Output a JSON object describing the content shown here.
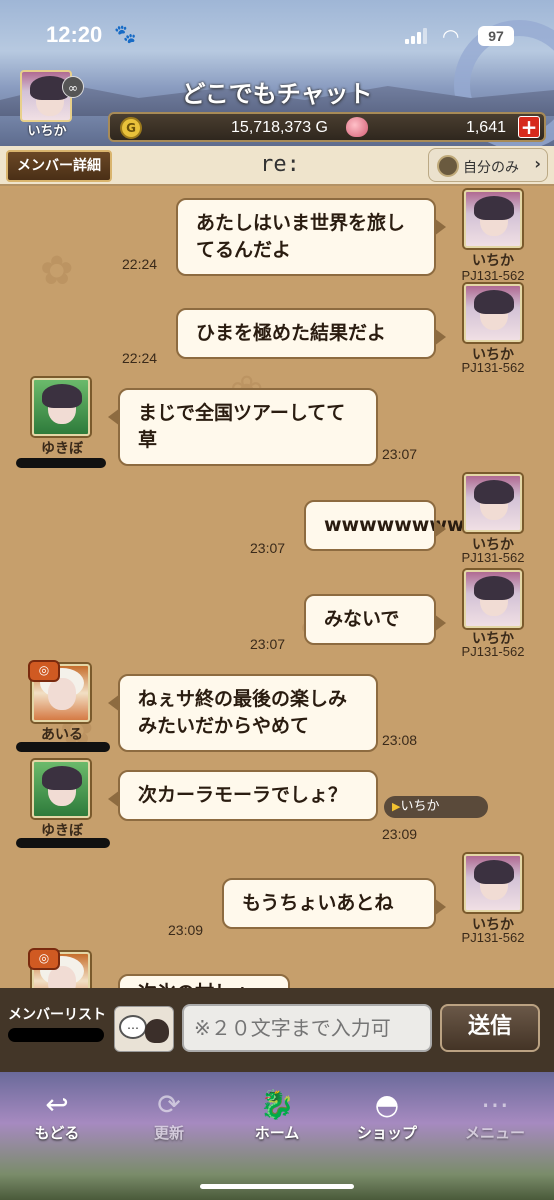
{
  "status_bar": {
    "time": "12:20",
    "battery": "97"
  },
  "header": {
    "title": "どこでもチャット",
    "my_name": "いちか",
    "gold": "15,718,373 G",
    "gold_icon": "G",
    "gems": "1,641",
    "plus": "+"
  },
  "chat_bar": {
    "member_detail": "メンバー詳細",
    "room_name": "re:",
    "scope": "自分のみ"
  },
  "messages": [
    {
      "side": "right",
      "author": "いちか",
      "author_id": "PJ131-562",
      "text": "あたしはいま世界を旅してるんだよ",
      "time": "22:24"
    },
    {
      "side": "right",
      "author": "いちか",
      "author_id": "PJ131-562",
      "text": "ひまを極めた結果だよ",
      "time": "22:24"
    },
    {
      "side": "left",
      "author": "ゆきぼ",
      "text": "まじで全国ツアーしてて草",
      "time": "23:07"
    },
    {
      "side": "right",
      "author": "いちか",
      "author_id": "PJ131-562",
      "text": "wwwwwwww",
      "time": "23:07"
    },
    {
      "side": "right",
      "author": "いちか",
      "author_id": "PJ131-562",
      "text": "みないで",
      "time": "23:07"
    },
    {
      "side": "left",
      "author": "あいる",
      "text": "ねぇサ終の最後の楽しみみたいだからやめて",
      "time": "23:08"
    },
    {
      "side": "left",
      "author": "ゆきぼ",
      "text": "次カーラモーラでしょ？",
      "time": "23:09",
      "reply_to": "いちか"
    },
    {
      "side": "right",
      "author": "いちか",
      "author_id": "PJ131-562",
      "text": "もうちょいあとね",
      "time": "23:09"
    },
    {
      "side": "left",
      "author": "",
      "text": "次氷の村しょ",
      "time": ""
    }
  ],
  "input": {
    "member_list": "メンバーリスト",
    "placeholder": "※２０文字まで入力可",
    "send": "送信",
    "stamp_text": "…"
  },
  "nav": {
    "back": "もどる",
    "refresh": "更新",
    "home": "ホーム",
    "shop": "ショップ",
    "menu": "メニュー"
  }
}
